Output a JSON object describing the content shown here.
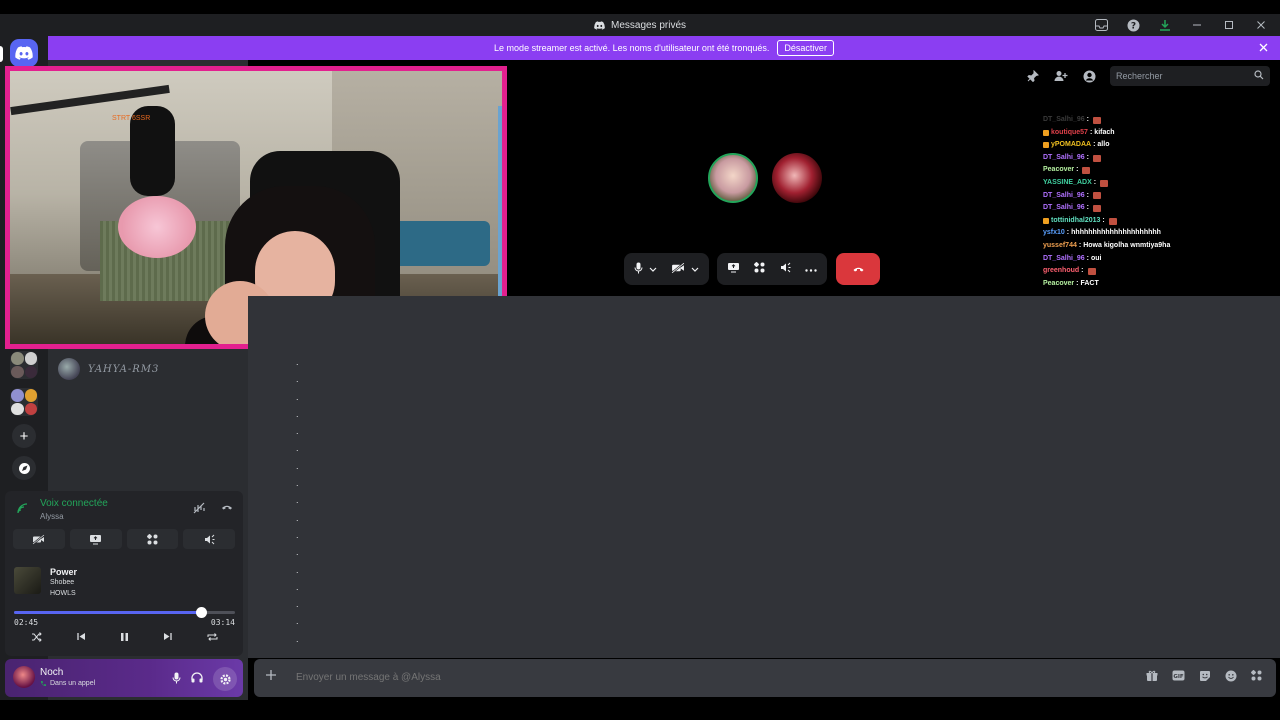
{
  "window": {
    "title": "Messages privés"
  },
  "banner": {
    "text": "Le mode streamer est activé. Les noms d'utilisateur ont été tronqués.",
    "button": "Désactiver"
  },
  "sidebar": {
    "dm_name": "YAHYA-RM3"
  },
  "voice": {
    "status": "Voix connectée",
    "channel": "Alyssa"
  },
  "media": {
    "track": "Power",
    "artist": "Shobee",
    "album": "HOWLS",
    "elapsed": "02:45",
    "duration": "03:14",
    "progress_fraction": 0.85
  },
  "user": {
    "name": "Noch",
    "status": "Dans un appel"
  },
  "search": {
    "placeholder": "Rechercher"
  },
  "composer": {
    "placeholder": "Envoyer un message à @Alyssa"
  },
  "webcam": {
    "stamp": "STRT 6SSR"
  },
  "chat": [
    {
      "user": "DT_Salhi_96",
      "color": "#3a3a3a",
      "text": "",
      "badge": false,
      "emote": true
    },
    {
      "user": "koutique57",
      "color": "#e0404a",
      "text": "kifach",
      "badge": true,
      "emote": false
    },
    {
      "user": "yPOMADAA",
      "color": "#f0c020",
      "text": "allo",
      "badge": true,
      "emote": false
    },
    {
      "user": "DT_Salhi_96",
      "color": "#b070ff",
      "text": "",
      "badge": false,
      "emote": true
    },
    {
      "user": "Peacover",
      "color": "#b5f0a0",
      "text": "",
      "badge": false,
      "emote": true
    },
    {
      "user": "YASSINE_ADX",
      "color": "#40d0a0",
      "text": "",
      "badge": false,
      "emote": true
    },
    {
      "user": "DT_Salhi_96",
      "color": "#b070ff",
      "text": "",
      "badge": false,
      "emote": true
    },
    {
      "user": "DT_Salhi_96",
      "color": "#b070ff",
      "text": "",
      "badge": false,
      "emote": true
    },
    {
      "user": "tottinidhal2013",
      "color": "#60e0c0",
      "text": "",
      "badge": true,
      "emote": true
    },
    {
      "user": "ysfx10",
      "color": "#5aa0ff",
      "text": "hhhhhhhhhhhhhhhhhhhhh",
      "badge": false,
      "emote": false
    },
    {
      "user": "yussef744",
      "color": "#f0a050",
      "text": "Howa kigolha wnmtiya9ha",
      "badge": false,
      "emote": false
    },
    {
      "user": "DT_Salhi_96",
      "color": "#b070ff",
      "text": "oui",
      "badge": false,
      "emote": false
    },
    {
      "user": "greenhoud",
      "color": "#ff6070",
      "text": "",
      "badge": false,
      "emote": true
    },
    {
      "user": "Peacover",
      "color": "#b5f0a0",
      "text": "FACT",
      "badge": false,
      "emote": false
    }
  ],
  "colors": {
    "accent": "#5865f2",
    "banner": "#8b3ef2",
    "connected": "#23a55a",
    "hangup": "#da373c",
    "webcam_border": "#e3208f"
  }
}
